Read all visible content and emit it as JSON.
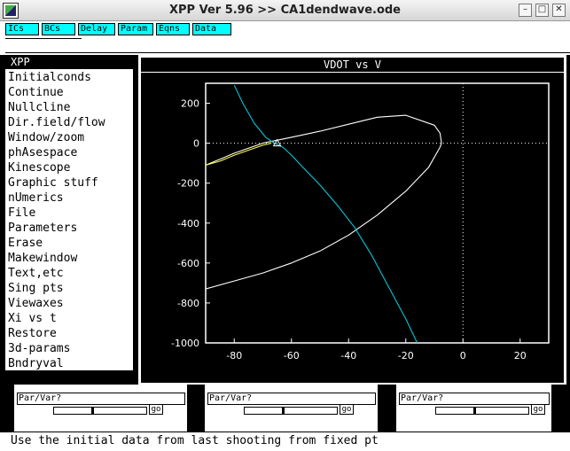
{
  "window": {
    "title": "XPP Ver 5.96 >> CA1dendwave.ode",
    "minimize": "–",
    "maximize": "□",
    "close": "✕"
  },
  "toolbar": {
    "buttons": [
      "ICs",
      "BCs",
      "Delay",
      "Param",
      "Eqns",
      "Data"
    ]
  },
  "menu": {
    "title": "XPP",
    "items": [
      "Initialconds",
      "Continue",
      "Nullcline",
      "Dir.field/flow",
      "Window/zoom",
      "phAsespace",
      "Kinescope",
      "Graphic stuff",
      "nUmerics",
      "File",
      "Parameters",
      "Erase",
      "Makewindow",
      "Text,etc",
      "Sing pts",
      "Viewaxes",
      "Xi vs t",
      "Restore",
      "3d-params",
      "Bndryval"
    ]
  },
  "graph": {
    "title": "VDOT vs V"
  },
  "chart_data": {
    "type": "line",
    "xlim": [
      -90,
      30
    ],
    "ylim": [
      -1000,
      300
    ],
    "xticks": [
      -80,
      -60,
      -40,
      -20,
      0,
      20
    ],
    "yticks": [
      200,
      0,
      -200,
      -400,
      -600,
      -800,
      -1000
    ],
    "xtick_labels": [
      "-80",
      "-60",
      "-40",
      "-20",
      "0",
      "20"
    ],
    "ytick_labels": [
      "200",
      "0",
      "-200",
      "-400",
      "-600",
      "-800",
      "-1000"
    ],
    "grid": false,
    "zero_lines": "dotted",
    "series": [
      {
        "color": "#ffffff",
        "x": [
          -90,
          -80,
          -70,
          -60,
          -50,
          -40,
          -30,
          -20,
          -12,
          -8,
          -7.5,
          -8,
          -10,
          -20,
          -30,
          -40,
          -50,
          -60,
          -70,
          -80,
          -90
        ],
        "y": [
          -730,
          -690,
          -650,
          -600,
          -540,
          -460,
          -360,
          -240,
          -120,
          -20,
          0,
          50,
          90,
          140,
          130,
          95,
          60,
          30,
          0,
          -50,
          -110
        ]
      },
      {
        "color": "#00c8d8",
        "x": [
          -80,
          -77,
          -73,
          -69,
          -66,
          -63,
          -60,
          -56,
          -50,
          -44,
          -38,
          -32,
          -26,
          -20,
          -16
        ],
        "y": [
          290,
          200,
          100,
          30,
          0,
          -20,
          -60,
          -120,
          -210,
          -310,
          -420,
          -560,
          -720,
          -880,
          -1000
        ]
      },
      {
        "color": "#ffff33",
        "x": [
          -90,
          -85,
          -80,
          -75,
          -70,
          -67
        ],
        "y": [
          -110,
          -90,
          -60,
          -35,
          -10,
          0
        ]
      }
    ],
    "fixed_point": {
      "x": -65,
      "y": 0
    }
  },
  "sliders": [
    {
      "label": "Par/Var?",
      "go": "go",
      "level": 0.42
    },
    {
      "label": "Par/Var?",
      "go": "go",
      "level": 0.42
    },
    {
      "label": "Par/Var?",
      "go": "go",
      "level": 0.42
    }
  ],
  "status": {
    "text": "Use the initial data from last shooting from fixed pt"
  }
}
